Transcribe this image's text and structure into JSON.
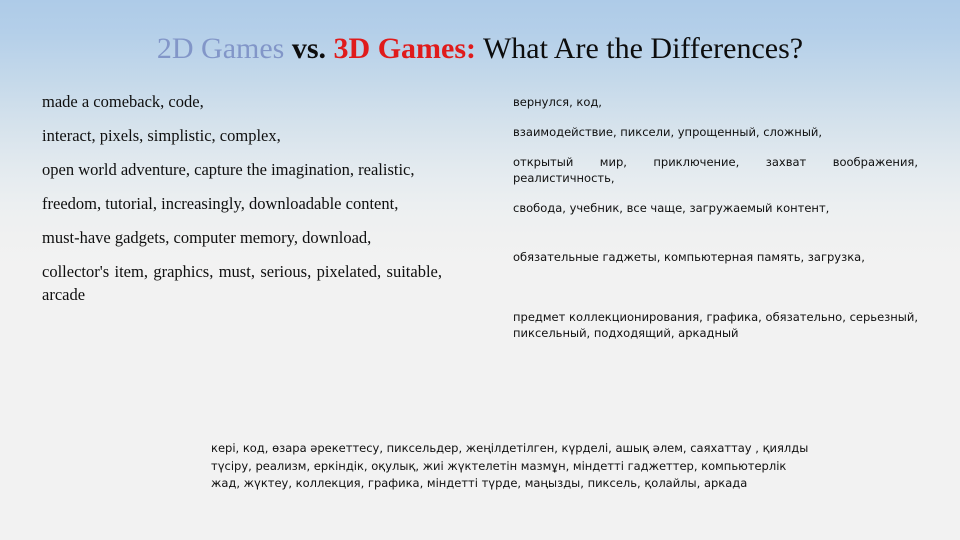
{
  "slide": {
    "background": {
      "top_color": "#aecbe8",
      "bottom_color": "#f2f2f2"
    },
    "title": {
      "part_2d": "2D Games",
      "part_vs": " vs. ",
      "part_3d": "3D Games:",
      "part_rest": " What Are the Differences?",
      "color_2d": "#8296c8",
      "color_vs": "#0d0d0d",
      "color_3d": "#e01b1b",
      "color_rest": "#0d0d0d"
    },
    "left_column": {
      "language": "English",
      "paragraphs": [
        "made a comeback, code,",
        "interact, pixels, simplistic, complex,",
        "open world adventure, capture the imagination, realistic,",
        "freedom, tutorial, increasingly, downloadable content,",
        "must-have gadgets, computer memory, download,",
        "collector's item, graphics, must, serious, pixelated, suitable, arcade"
      ]
    },
    "right_column": {
      "language": "Russian",
      "paragraphs": [
        "вернулся, код,",
        "взаимодействие, пиксели, упрощенный, сложный,",
        "открытый мир, приключение, захват воображения, реалистичность,",
        "свобода, учебник, все чаще, загружаемый контент,",
        "обязательные гаджеты, компьютерная память, загрузка,",
        "предмет коллекционирования, графика, обязательно, серьезный, пиксельный, подходящий, аркадный"
      ]
    },
    "bottom_block": {
      "language": "Kazakh",
      "text": "кері, код, өзара әрекеттесу, пиксельдер, жеңілдетілген, күрделі, ашық әлем, саяхаттау , қиялды түсіру, реализм, еркіндік, оқулық, жиі жүктелетін мазмұн, міндетті гаджеттер, компьютерлік жад, жүктеу, коллекция, графика, міндетті түрде, маңызды, пиксель, қолайлы, аркада"
    }
  }
}
